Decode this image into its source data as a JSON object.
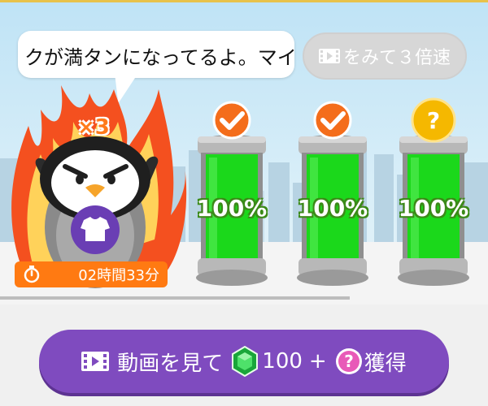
{
  "speech_bubble": {
    "text": "クが満タンになってるよ。マイルを"
  },
  "speed_button": {
    "label": "をみて３倍速",
    "icon": "video-icon"
  },
  "character": {
    "multiplier": "×3",
    "costume_icon": "shirt-icon"
  },
  "timer": {
    "icon": "stopwatch-icon",
    "remaining": "02時間33分"
  },
  "tanks": [
    {
      "fill_percent": 100,
      "label": "100%",
      "badge": "check"
    },
    {
      "fill_percent": 100,
      "label": "100%",
      "badge": "check"
    },
    {
      "fill_percent": 100,
      "label": "100%",
      "badge": "question"
    }
  ],
  "badge_text": {
    "question": "?"
  },
  "watch_button": {
    "icon": "video-icon",
    "label": "動画を見て",
    "gem_icon": "green-gem-icon",
    "gem_amount": "100",
    "plus": "+",
    "mystery_icon": "pink-question-icon",
    "mystery_text": "?",
    "suffix": "獲得"
  },
  "colors": {
    "tank_green": "#1bd81b",
    "accent_orange": "#ff7a12",
    "button_purple": "#7f4bbf",
    "disabled_gray": "#d7d7d7"
  }
}
